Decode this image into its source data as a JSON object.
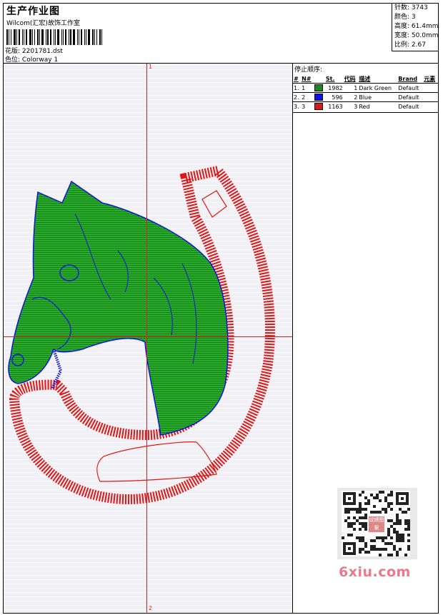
{
  "header": {
    "title": "生产作业图",
    "subtitle": "Wilcom(汇宏)故饰工作室",
    "pattern_label": "花版:",
    "pattern_value": "2201781.dst",
    "colorway_label": "色位:",
    "colorway_value": "Colorway 1"
  },
  "stats": [
    {
      "label": "针数:",
      "value": "3743"
    },
    {
      "label": "颜色:",
      "value": "3"
    },
    {
      "label": "高度:",
      "value": "61.4mm"
    },
    {
      "label": "宽度:",
      "value": "50.0mm"
    },
    {
      "label": "比例:",
      "value": "2.67"
    }
  ],
  "canvas": {
    "axis_top_label": "1",
    "axis_bottom_label": "2",
    "colors": {
      "green": "#1d9b1d",
      "blue": "#0b1fd8",
      "red": "#e01515",
      "axis": "#e02020"
    }
  },
  "stop_sequence": {
    "title": "停止顺序:",
    "columns": [
      "#",
      "N#",
      "St.",
      "代码",
      "描述",
      "Brand",
      "元素"
    ],
    "rows": [
      {
        "index": "1.",
        "n": "1",
        "color": "#1a8a1a",
        "stitches": "1982",
        "code": "1",
        "description": "Dark Green",
        "brand": "Default"
      },
      {
        "index": "2.",
        "n": "2",
        "color": "#0b14e0",
        "stitches": "596",
        "code": "2",
        "description": "Blue",
        "brand": "Default"
      },
      {
        "index": "3.",
        "n": "3",
        "color": "#e01515",
        "stitches": "1163",
        "code": "3",
        "description": "Red",
        "brand": "Default"
      }
    ]
  },
  "qr_stamp": "纹绣图案",
  "watermark": "6xiu.com"
}
